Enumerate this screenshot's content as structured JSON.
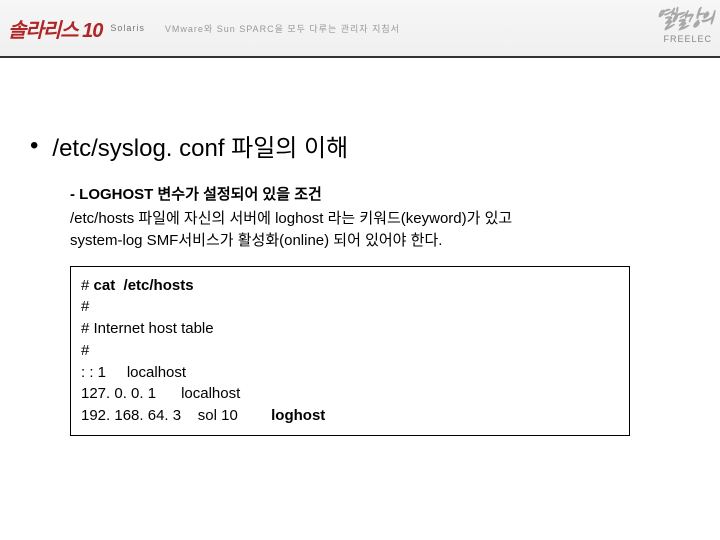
{
  "header": {
    "logo_text": "솔라리스 10",
    "sub_logo": "Solaris",
    "tagline": "VMware와 Sun SPARC을 모두 다루는 관리자 지침서",
    "brand_kor": "열혈강의",
    "brand_eng": "FREELEC"
  },
  "main": {
    "bullet": "•",
    "title": "/etc/syslog. conf 파일의 이해",
    "sub_heading": "- LOGHOST 변수가 설정되어 있을 조건",
    "sub_body_1": "/etc/hosts 파일에 자신의 서버에 loghost 라는 키워드(keyword)가 있고",
    "sub_body_2": "system-log SMF서비스가 활성화(online) 되어 있어야 한다."
  },
  "code": {
    "prompt": "# ",
    "command": "cat  /etc/hosts",
    "lines": [
      "#",
      "# Internet host table",
      "#",
      ": : 1     localhost",
      "127. 0. 0. 1      localhost"
    ],
    "last_line_left": "192. 168. 64. 3    sol 10",
    "last_line_bold": "loghost"
  }
}
